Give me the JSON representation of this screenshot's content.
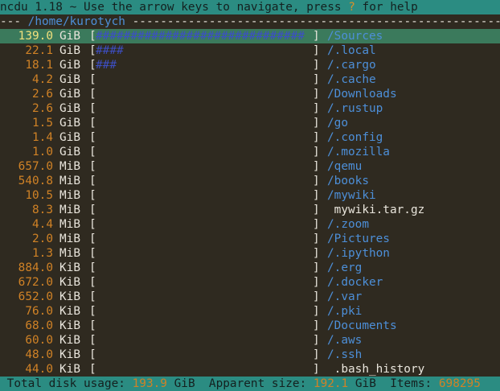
{
  "title": {
    "prefix": "ncdu 1.18 ~ Use the arrow keys to navigate, press ",
    "key": "?",
    "suffix": " for help"
  },
  "path": {
    "dashes_left": "--- ",
    "current": "/home/kurotych",
    "dashes_right": " ------------------------------------------------------------------"
  },
  "entries": [
    {
      "size": "139.0",
      "unit": "GiB",
      "graph": "##############################",
      "name": "/Sources",
      "is_dir": true,
      "selected": true
    },
    {
      "size": "22.1",
      "unit": "GiB",
      "graph": "####",
      "name": "/.local",
      "is_dir": true,
      "selected": false
    },
    {
      "size": "18.1",
      "unit": "GiB",
      "graph": "###",
      "name": "/.cargo",
      "is_dir": true,
      "selected": false
    },
    {
      "size": "4.2",
      "unit": "GiB",
      "graph": "",
      "name": "/.cache",
      "is_dir": true,
      "selected": false
    },
    {
      "size": "2.6",
      "unit": "GiB",
      "graph": "",
      "name": "/Downloads",
      "is_dir": true,
      "selected": false
    },
    {
      "size": "2.6",
      "unit": "GiB",
      "graph": "",
      "name": "/.rustup",
      "is_dir": true,
      "selected": false
    },
    {
      "size": "1.5",
      "unit": "GiB",
      "graph": "",
      "name": "/go",
      "is_dir": true,
      "selected": false
    },
    {
      "size": "1.4",
      "unit": "GiB",
      "graph": "",
      "name": "/.config",
      "is_dir": true,
      "selected": false
    },
    {
      "size": "1.0",
      "unit": "GiB",
      "graph": "",
      "name": "/.mozilla",
      "is_dir": true,
      "selected": false
    },
    {
      "size": "657.0",
      "unit": "MiB",
      "graph": "",
      "name": "/qemu",
      "is_dir": true,
      "selected": false
    },
    {
      "size": "540.8",
      "unit": "MiB",
      "graph": "",
      "name": "/books",
      "is_dir": true,
      "selected": false
    },
    {
      "size": "10.5",
      "unit": "MiB",
      "graph": "",
      "name": "/mywiki",
      "is_dir": true,
      "selected": false
    },
    {
      "size": "8.3",
      "unit": "MiB",
      "graph": "",
      "name": " mywiki.tar.gz",
      "is_dir": false,
      "selected": false
    },
    {
      "size": "4.4",
      "unit": "MiB",
      "graph": "",
      "name": "/.zoom",
      "is_dir": true,
      "selected": false
    },
    {
      "size": "2.0",
      "unit": "MiB",
      "graph": "",
      "name": "/Pictures",
      "is_dir": true,
      "selected": false
    },
    {
      "size": "1.3",
      "unit": "MiB",
      "graph": "",
      "name": "/.ipython",
      "is_dir": true,
      "selected": false
    },
    {
      "size": "884.0",
      "unit": "KiB",
      "graph": "",
      "name": "/.erg",
      "is_dir": true,
      "selected": false
    },
    {
      "size": "672.0",
      "unit": "KiB",
      "graph": "",
      "name": "/.docker",
      "is_dir": true,
      "selected": false
    },
    {
      "size": "652.0",
      "unit": "KiB",
      "graph": "",
      "name": "/.var",
      "is_dir": true,
      "selected": false
    },
    {
      "size": "76.0",
      "unit": "KiB",
      "graph": "",
      "name": "/.pki",
      "is_dir": true,
      "selected": false
    },
    {
      "size": "68.0",
      "unit": "KiB",
      "graph": "",
      "name": "/Documents",
      "is_dir": true,
      "selected": false
    },
    {
      "size": "60.0",
      "unit": "KiB",
      "graph": "",
      "name": "/.aws",
      "is_dir": true,
      "selected": false
    },
    {
      "size": "48.0",
      "unit": "KiB",
      "graph": "",
      "name": "/.ssh",
      "is_dir": true,
      "selected": false
    },
    {
      "size": "44.0",
      "unit": "KiB",
      "graph": "",
      "name": " .bash_history",
      "is_dir": false,
      "selected": false
    }
  ],
  "status": {
    "total_label": " Total disk usage: ",
    "total_value": "193.9",
    "total_unit": " GiB",
    "apparent_label": "  Apparent size: ",
    "apparent_value": "192.1",
    "apparent_unit": " GiB",
    "items_label": "  Items: ",
    "items_value": "698295"
  },
  "colors": {
    "background": "#2f2a20",
    "bar": "#2b8c82",
    "selected_row": "#3b7a5c",
    "size": "#d08226",
    "dir_name": "#4d8fd8",
    "graph": "#3d4ec0"
  }
}
